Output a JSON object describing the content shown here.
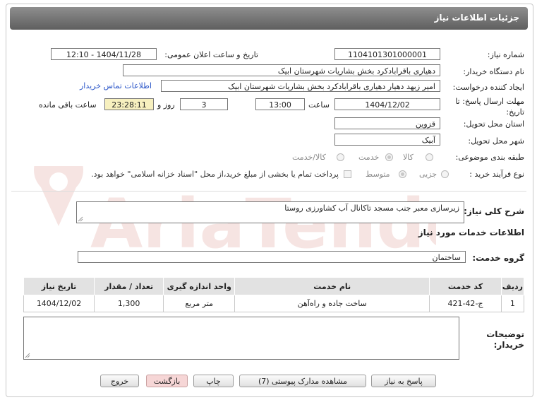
{
  "window": {
    "title": "جزئیات اطلاعات نیاز"
  },
  "fields": {
    "need_number": {
      "label": "شماره نیاز:",
      "value": "1104101301000001"
    },
    "announce_datetime": {
      "label": "تاریخ و ساعت اعلان عمومی:",
      "value": "1404/11/28 - 12:10"
    },
    "buyer_org": {
      "label": "نام دستگاه خریدار:",
      "value": "دهیاری باقرابادکرد بخش بشاریات شهرستان ابیک"
    },
    "requester": {
      "label": "ایجاد کننده درخواست:",
      "value": "امیر زبهد دهیار دهیاری باقرابادکرد بخش بشاریات شهرستان ابیک"
    },
    "contact_link": "اطلاعات تماس خریدار",
    "deadline": {
      "label": "مهلت ارسال پاسخ: تا تاریخ:",
      "date": "1404/12/02",
      "time_label": "ساعت",
      "time": "13:00",
      "days": "3",
      "days_label": "روز و",
      "remaining": "23:28:11",
      "remaining_label": "ساعت باقی مانده"
    },
    "province": {
      "label": "استان محل تحویل:",
      "value": "قزوین"
    },
    "city": {
      "label": "شهر محل تحویل:",
      "value": "آبیک"
    },
    "category": {
      "label": "طبقه بندی موضوعی:",
      "options": [
        "کالا",
        "خدمت",
        "کالا/خدمت"
      ],
      "selected": "خدمت"
    },
    "purchase_type": {
      "label": "نوع فرآیند خرید :",
      "options": [
        "جزیی",
        "متوسط"
      ],
      "selected": "متوسط",
      "payment_note": "پرداخت تمام یا بخشی از مبلغ خرید،از محل \"اسناد خزانه اسلامی\" خواهد بود."
    }
  },
  "summary": {
    "label": "شرح کلی نیاز:",
    "value": "زیرسازی معبر جنب مسجد تاکانال آب کشاورزی روستا"
  },
  "services_heading": "اطلاعات خدمات مورد نیاز",
  "service_group": {
    "label": "گروه خدمت:",
    "value": "ساختمان"
  },
  "table": {
    "headers": [
      "ردیف",
      "کد خدمت",
      "نام خدمت",
      "واحد اندازه گیری",
      "تعداد / مقدار",
      "تاریخ نیاز"
    ],
    "rows": [
      [
        "1",
        "ج-42-421",
        "ساخت جاده و راه‌آهن",
        "متر مربع",
        "1,300",
        "1404/12/02"
      ]
    ]
  },
  "buyer_notes": {
    "label_line1": "توضیحات",
    "label_line2": "خریدار:",
    "value": ""
  },
  "buttons": {
    "reply": "پاسخ به نیاز",
    "attachments": "مشاهده مدارک پیوستی (7)",
    "print": "چاپ",
    "back": "بازگشت",
    "exit": "خروج"
  },
  "watermark": "AriaTender.net",
  "colors": {
    "title_bar": "#6f6f6f",
    "link": "#2a55c8",
    "remaining_bg": "#f7f0bf",
    "watermark": "#c0392b"
  }
}
